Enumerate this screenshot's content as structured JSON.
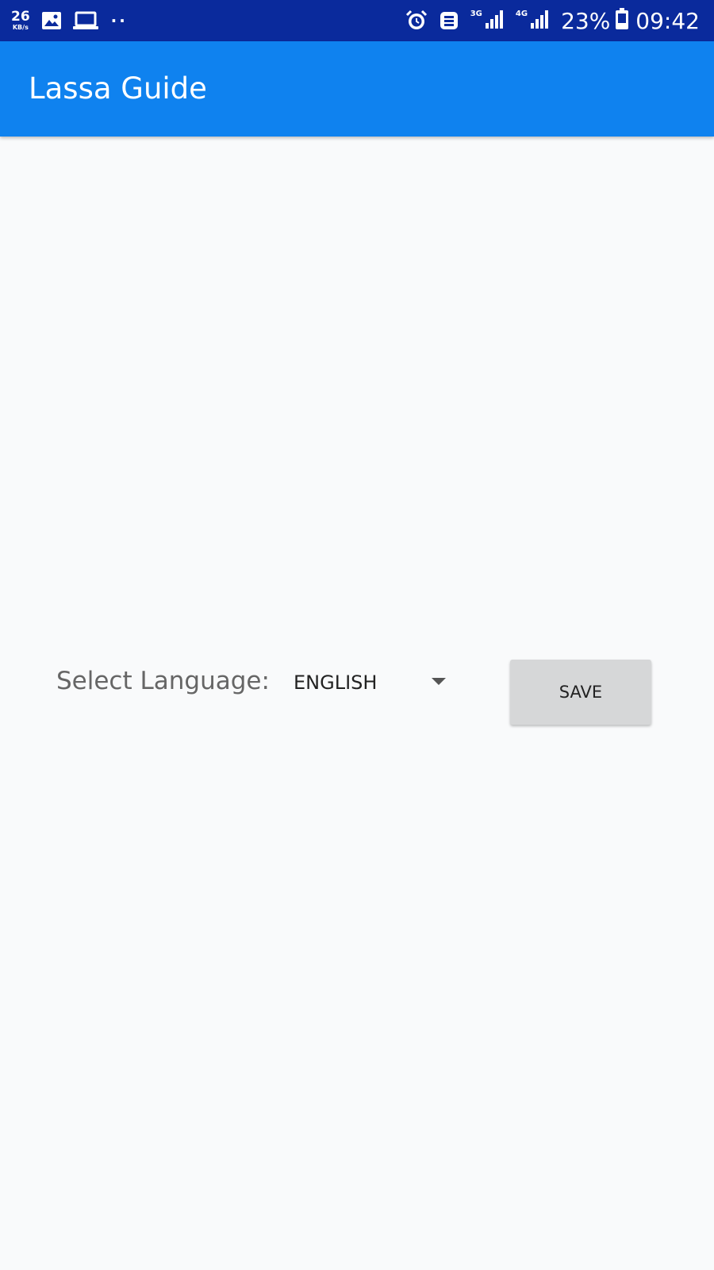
{
  "status_bar": {
    "net_speed_value": "26",
    "net_speed_unit": "KB/s",
    "notification_icons": [
      "image-icon",
      "laptop-icon"
    ],
    "more_dots": "··",
    "sim1_network": "3G",
    "sim2_network": "4G",
    "battery_percent": "23%",
    "time": "09:42"
  },
  "app_bar": {
    "title": "Lassa Guide",
    "background": "#0f82ef"
  },
  "language_form": {
    "label": "Select Language:",
    "selected_language": "ENGLISH",
    "save_label": "SAVE"
  },
  "colors": {
    "status_bar": "#0a2a9c",
    "app_bar": "#0f82ef",
    "background": "#f9fafb",
    "button": "#d6d7d8"
  }
}
